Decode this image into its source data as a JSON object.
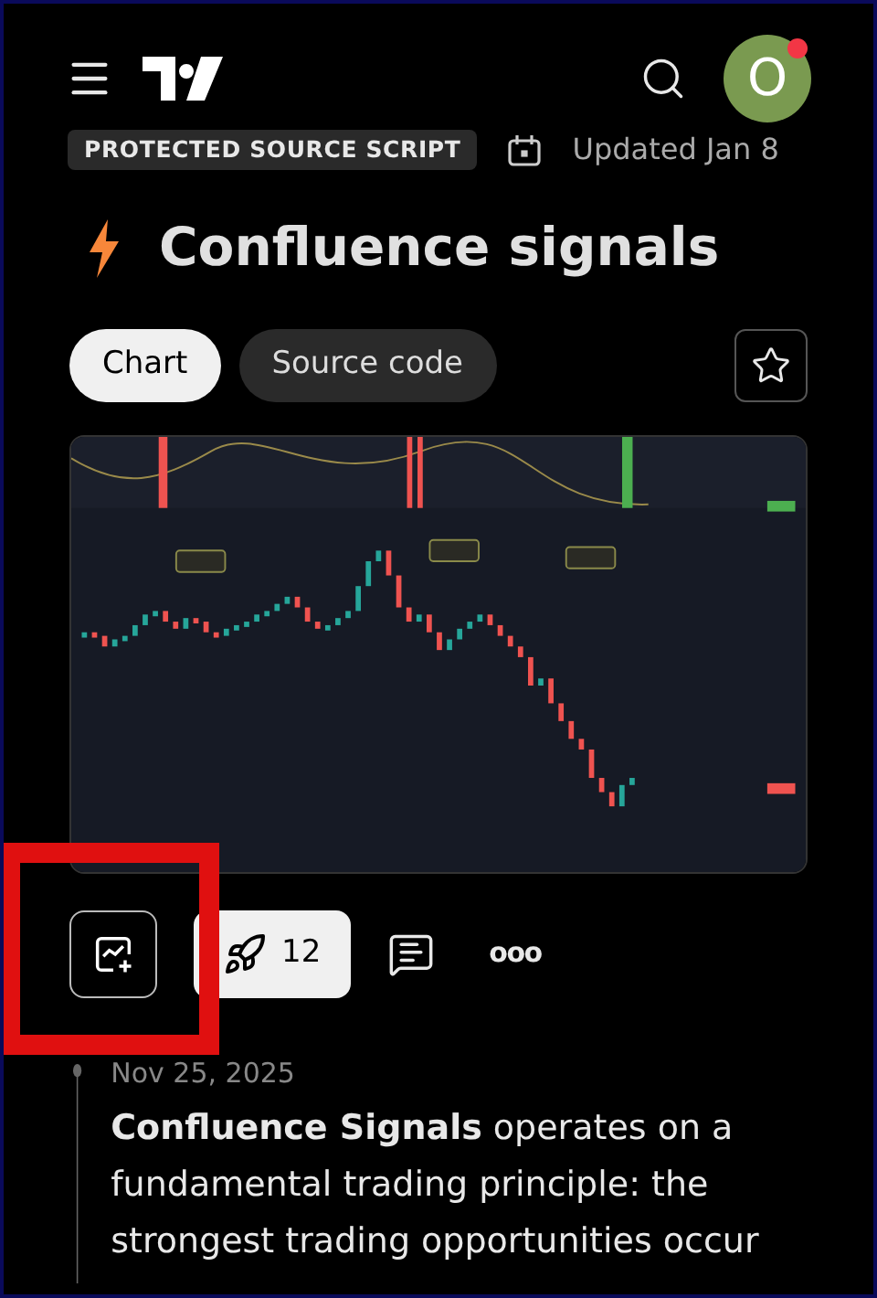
{
  "header": {
    "avatar_letter": "O",
    "notification": true
  },
  "script": {
    "badge": "PROTECTED SOURCE SCRIPT",
    "updated": "Updated Jan 8",
    "title": "Confluence signals"
  },
  "tabs": [
    {
      "label": "Chart",
      "selected": true
    },
    {
      "label": "Source code",
      "selected": false
    }
  ],
  "favorite": {
    "checked": false
  },
  "actions": {
    "add_to_chart_highlighted": true,
    "boosts": "12",
    "more": "ooo"
  },
  "post": {
    "date": "Nov 25, 2025",
    "text": "**Confluence Signals** operates on a fundamental trading principle: the strongest trading opportunities occur"
  }
}
